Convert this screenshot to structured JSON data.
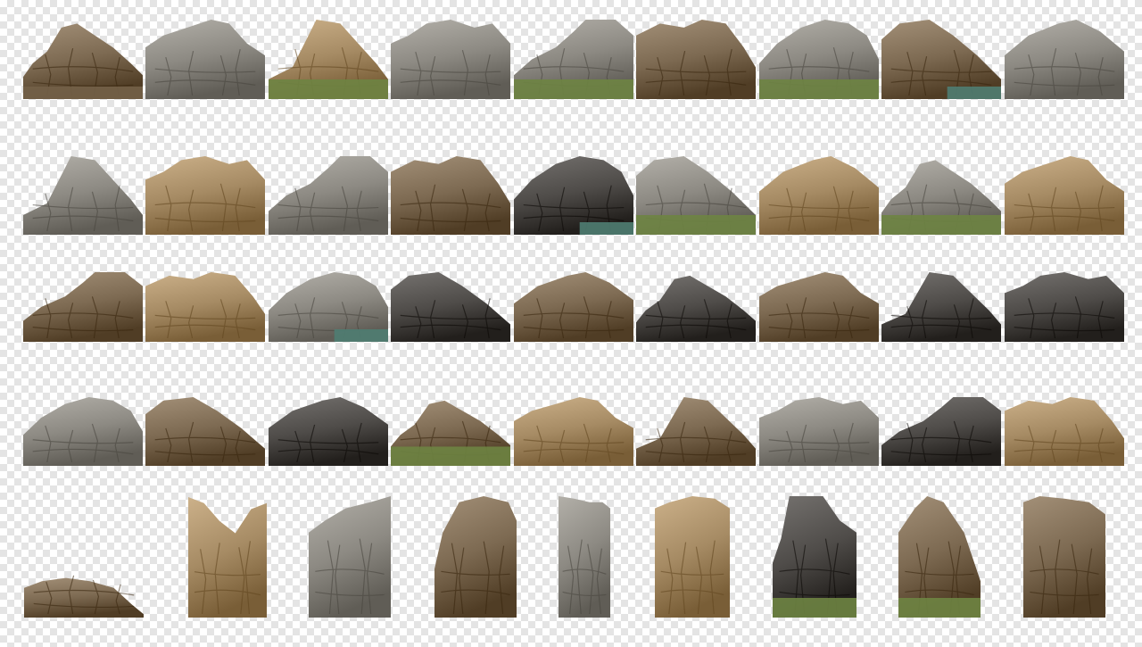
{
  "sheet": {
    "background": "transparency-checkerboard",
    "rows": [
      {
        "count": 9,
        "kind": "wide-outcrops"
      },
      {
        "count": 9,
        "kind": "wide-outcrops"
      },
      {
        "count": 9,
        "kind": "wide-outcrops"
      },
      {
        "count": 9,
        "kind": "wide-outcrops"
      },
      {
        "count": 9,
        "kind": "tall-rock-pillars"
      }
    ],
    "palette": {
      "gray": "#8d8a83",
      "tan": "#a68b64",
      "brown": "#7d6a52",
      "dark": "#4f4c49",
      "grass": "#6e8443",
      "water": "#4f7d72"
    }
  }
}
